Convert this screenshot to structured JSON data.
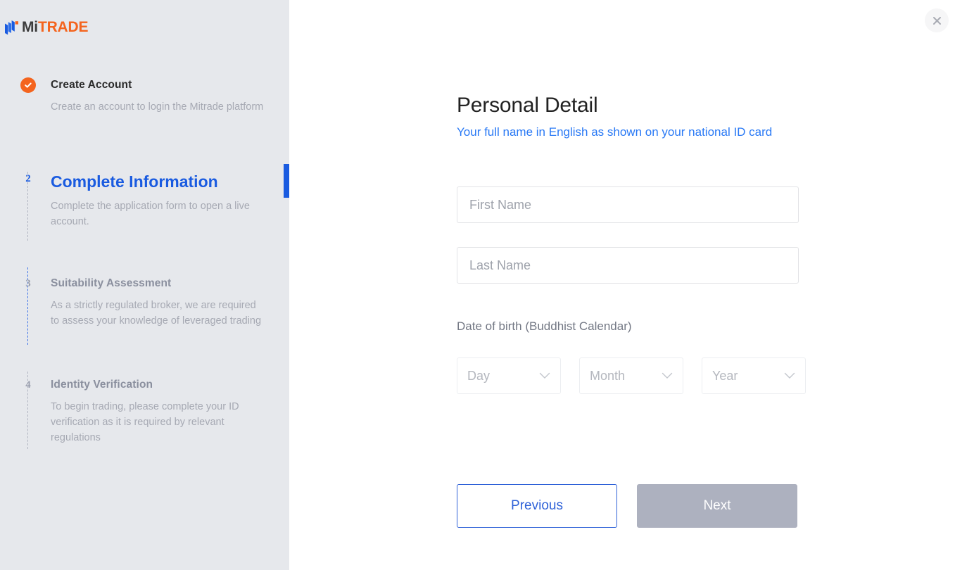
{
  "brand": {
    "logo_mark_icon": "mitrade-logo-icon",
    "name_part1": "Mi",
    "name_part2": "TRADE",
    "color_primary_blue": "#1a5be0",
    "color_accent_orange": "#f4641e"
  },
  "sidebar": {
    "background_color": "#e6e8ec",
    "steps": [
      {
        "number": "1",
        "marker": "check-icon",
        "completed": true,
        "active": false,
        "title": "Create Account",
        "description": "Create an account to login the Mitrade platform"
      },
      {
        "number": "2",
        "marker": "number",
        "completed": false,
        "active": true,
        "title": "Complete Information",
        "description": "Complete the application form to open a live account."
      },
      {
        "number": "3",
        "marker": "number",
        "completed": false,
        "active": false,
        "title": "Suitability Assessment",
        "description": "As a strictly regulated broker, we are required to assess your knowledge of leveraged trading"
      },
      {
        "number": "4",
        "marker": "number",
        "completed": false,
        "active": false,
        "title": "Identity Verification",
        "description": "To begin trading, please complete your ID verification as it is required by relevant regulations"
      }
    ]
  },
  "main": {
    "close_icon": "close-icon",
    "title": "Personal Detail",
    "subtitle": "Your full name in English as shown on your national ID card",
    "subtitle_color": "#2979f5",
    "fields": {
      "first_name": {
        "value": "",
        "placeholder": "First Name"
      },
      "last_name": {
        "value": "",
        "placeholder": "Last Name"
      }
    },
    "dob": {
      "label": "Date of birth (Buddhist Calendar)",
      "day": {
        "value": "Day",
        "icon": "chevron-down-icon"
      },
      "month": {
        "value": "Month",
        "icon": "chevron-down-icon"
      },
      "year": {
        "value": "Year",
        "icon": "chevron-down-icon"
      }
    },
    "buttons": {
      "previous": "Previous",
      "next": "Next",
      "next_disabled": true
    }
  }
}
